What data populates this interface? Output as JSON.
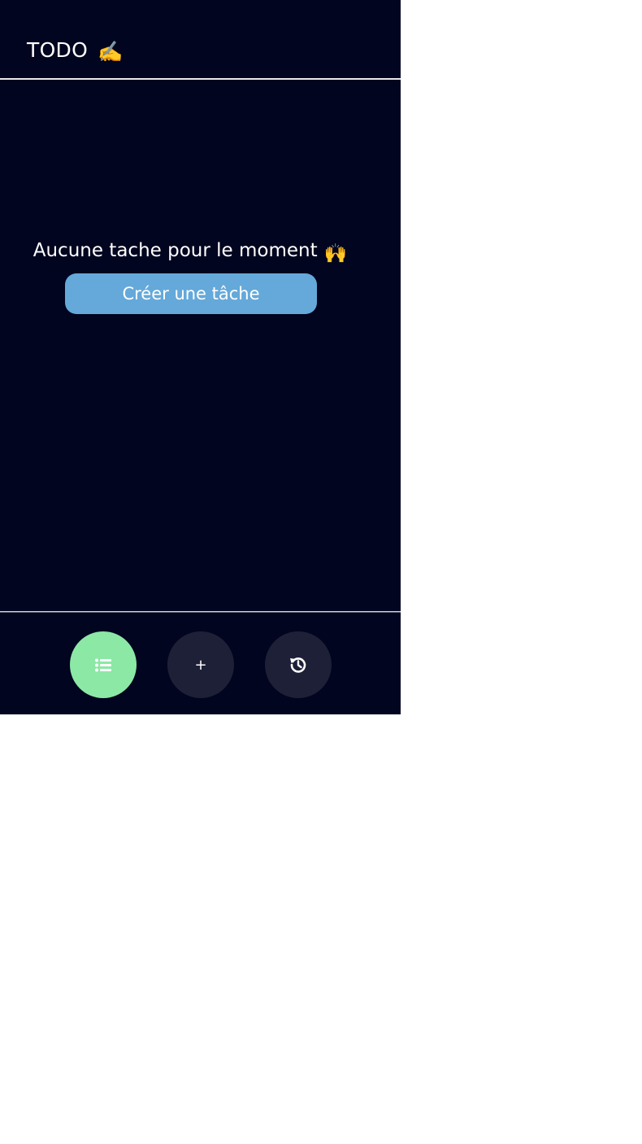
{
  "header": {
    "title": "TODO",
    "emoji": "✍️"
  },
  "empty_state": {
    "message": "Aucune tache pour le moment",
    "emoji": "🙌",
    "create_button_label": "Créer une tâche"
  },
  "bottom_nav": {
    "items": [
      {
        "name": "list",
        "icon": "list-icon",
        "label": "",
        "active": true,
        "color": "#8ce8a5"
      },
      {
        "name": "add",
        "icon": "plus-icon",
        "label": "+",
        "active": false,
        "color": "#1e2038"
      },
      {
        "name": "history",
        "icon": "history-icon",
        "label": "",
        "active": false,
        "color": "#1e2038"
      }
    ]
  },
  "colors": {
    "background": "#02051f",
    "button": "#64a9da",
    "nav_active": "#8ce8a5",
    "nav_inactive": "#1e2038"
  }
}
